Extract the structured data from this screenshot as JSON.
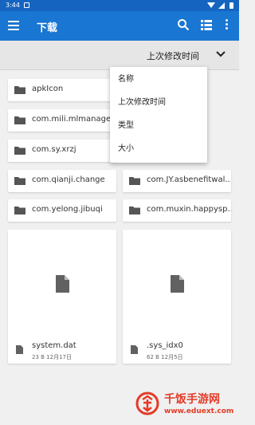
{
  "status_bar": {
    "time": "3:44"
  },
  "toolbar": {
    "title": "下载"
  },
  "sort_bar": {
    "label": "上次修改时间"
  },
  "sort_menu": {
    "items": [
      "名称",
      "上次修改时间",
      "类型",
      "大小"
    ]
  },
  "folders": [
    {
      "name": "apkIcon"
    },
    {
      "name": "com.mili.mlmanager"
    },
    {
      "name": "com.sy.xrzj"
    },
    {
      "name": "com.qianji.change"
    },
    {
      "name": "com.JY.asbenefitwal..."
    },
    {
      "name": "com.yelong.jibuqi"
    },
    {
      "name": "com.muxin.happysp..."
    }
  ],
  "files": [
    {
      "name": "system.dat",
      "meta": "23 B 12月17日"
    },
    {
      "name": ".sys_idx0",
      "meta": "62 B 12月5日"
    }
  ],
  "watermark": {
    "brand": "千饭手游网",
    "url": "www.eduext.com"
  },
  "colors": {
    "toolbar": "#1976d2",
    "statusbar": "#1565c0",
    "brand_red": "#e53a26"
  }
}
